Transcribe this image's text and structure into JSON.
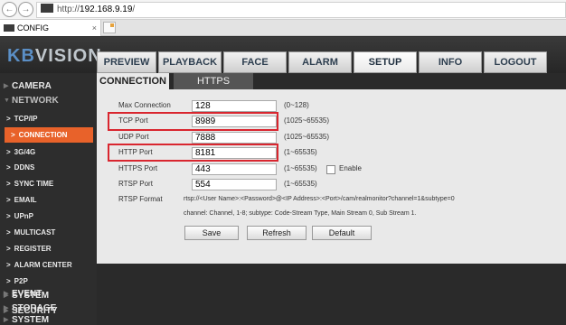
{
  "browser": {
    "url_prefix": "http://",
    "url_host": "192.168.9.19",
    "url_suffix": "/",
    "tab_title": "CONFIG",
    "tab_close": "×"
  },
  "app": {
    "logo_kb": "KB",
    "logo_rest": "VISION",
    "main_tabs": [
      "PREVIEW",
      "PLAYBACK",
      "FACE SEARCH",
      "ALARM",
      "SETUP",
      "INFO",
      "LOGOUT"
    ],
    "active_main_tab": "SETUP"
  },
  "sidebar": {
    "sections": [
      "CAMERA",
      "NETWORK",
      "EVENT",
      "STORAGE",
      "SYSTEM",
      "SECURITY"
    ],
    "network_items": [
      "TCP/IP",
      "CONNECTION",
      "3G/4G",
      "DDNS",
      "SYNC TIME",
      "EMAIL",
      "UPnP",
      "MULTICAST",
      "REGISTER",
      "ALARM CENTER",
      "P2P"
    ],
    "active_item": "CONNECTION"
  },
  "subtabs": {
    "connection": "CONNECTION",
    "https": "HTTPS"
  },
  "form": {
    "max_connection": {
      "label": "Max Connection",
      "value": "128",
      "hint": "(0~128)"
    },
    "tcp_port": {
      "label": "TCP Port",
      "value": "8989",
      "hint": "(1025~65535)"
    },
    "udp_port": {
      "label": "UDP Port",
      "value": "7888",
      "hint": "(1025~65535)"
    },
    "http_port": {
      "label": "HTTP Port",
      "value": "8181",
      "hint": "(1~65535)"
    },
    "https_port": {
      "label": "HTTPS Port",
      "value": "443",
      "hint": "(1~65535)",
      "enable_label": "Enable"
    },
    "rtsp_port": {
      "label": "RTSP Port",
      "value": "554",
      "hint": "(1~65535)"
    },
    "rtsp_format": {
      "label": "RTSP Format",
      "line1": "rtsp://<User Name>:<Password>@<IP Address>:<Port>/cam/realmonitor?channel=1&subtype=0",
      "line2": "channel: Channel, 1-8; subtype: Code-Stream Type, Main Stream 0, Sub Stream 1."
    }
  },
  "buttons": {
    "save": "Save",
    "refresh": "Refresh",
    "default": "Default"
  },
  "colors": {
    "active_item": "#e8622a",
    "highlight": "#d9262f",
    "logo_kb": "#5b8fc6"
  }
}
